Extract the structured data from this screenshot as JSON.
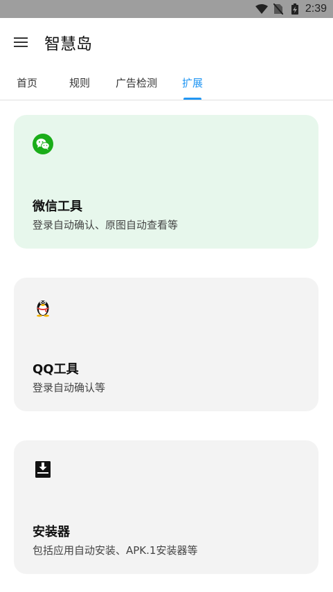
{
  "status_bar": {
    "time": "2:39"
  },
  "app_bar": {
    "title": "智慧岛"
  },
  "tabs": [
    {
      "label": "首页"
    },
    {
      "label": "规则"
    },
    {
      "label": "广告检测"
    },
    {
      "label": "扩展"
    }
  ],
  "active_tab": "扩展",
  "cards": [
    {
      "title": "微信工具",
      "desc": "登录自动确认、原图自动查看等",
      "icon": "wechat-icon",
      "bg": "#e7f7ec"
    },
    {
      "title": "QQ工具",
      "desc": "登录自动确认等",
      "icon": "qq-penguin-icon",
      "bg": "#f3f3f3"
    },
    {
      "title": "安装器",
      "desc": "包括应用自动安装、APK.1安装器等",
      "icon": "installer-icon",
      "bg": "#f3f3f3"
    }
  ],
  "colors": {
    "accent": "#2196f3",
    "wechat_green": "#1aad19",
    "status_bar": "#9e9e9e"
  }
}
